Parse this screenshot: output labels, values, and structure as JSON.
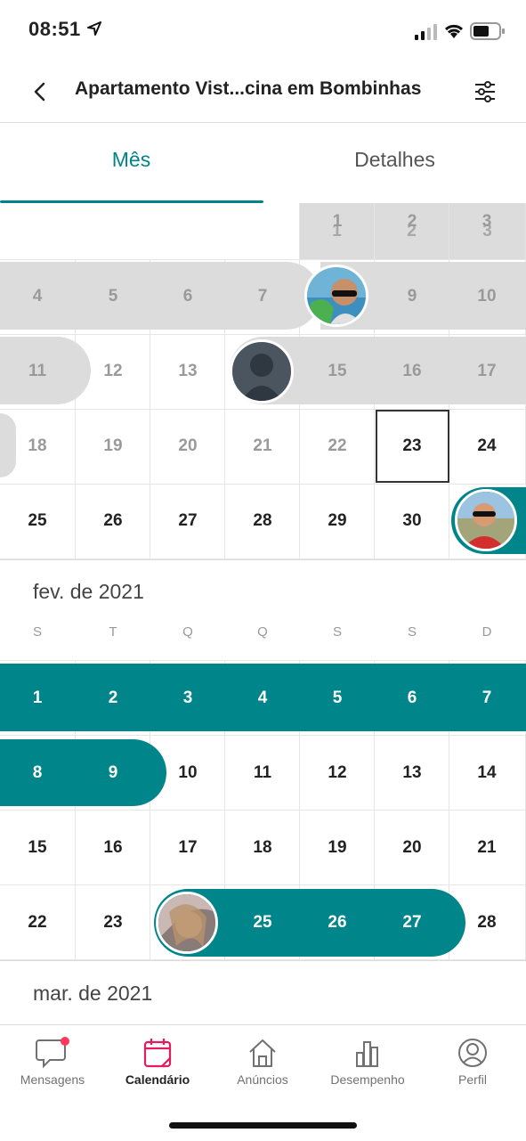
{
  "status_bar": {
    "time": "08:51"
  },
  "header": {
    "title": "Apartamento Vist...cina em Bombinhas"
  },
  "tabs": [
    {
      "label": "Mês"
    },
    {
      "label": "Detalhes"
    }
  ],
  "january": {
    "rows": [
      [
        "",
        "",
        "",
        "",
        "1",
        "2",
        "3"
      ],
      [
        "4",
        "5",
        "6",
        "7",
        "8",
        "9",
        "10"
      ],
      [
        "11",
        "12",
        "13",
        "14",
        "15",
        "16",
        "17"
      ],
      [
        "18",
        "19",
        "20",
        "21",
        "22",
        "23",
        "24"
      ],
      [
        "25",
        "26",
        "27",
        "28",
        "29",
        "30",
        "31"
      ]
    ],
    "today": "23"
  },
  "february": {
    "label": "fev. de 2021",
    "weekdays": [
      "S",
      "T",
      "Q",
      "Q",
      "S",
      "S",
      "D"
    ],
    "rows": [
      [
        "1",
        "2",
        "3",
        "4",
        "5",
        "6",
        "7"
      ],
      [
        "8",
        "9",
        "10",
        "11",
        "12",
        "13",
        "14"
      ],
      [
        "15",
        "16",
        "17",
        "18",
        "19",
        "20",
        "21"
      ],
      [
        "22",
        "23",
        "24",
        "25",
        "26",
        "27",
        "28"
      ]
    ]
  },
  "march": {
    "label": "mar. de 2021"
  },
  "bottom_nav": [
    {
      "label": "Mensagens",
      "icon": "chat-icon"
    },
    {
      "label": "Calendário",
      "icon": "calendar-icon",
      "active": true
    },
    {
      "label": "Anúncios",
      "icon": "home-icon"
    },
    {
      "label": "Desempenho",
      "icon": "bar-chart-icon"
    },
    {
      "label": "Perfil",
      "icon": "profile-icon"
    }
  ],
  "colors": {
    "accent": "#008489",
    "reservation": "#00858a",
    "blocked": "#dcdcdc",
    "notification": "#ff385c",
    "calendar_active": "#e31c5f"
  }
}
